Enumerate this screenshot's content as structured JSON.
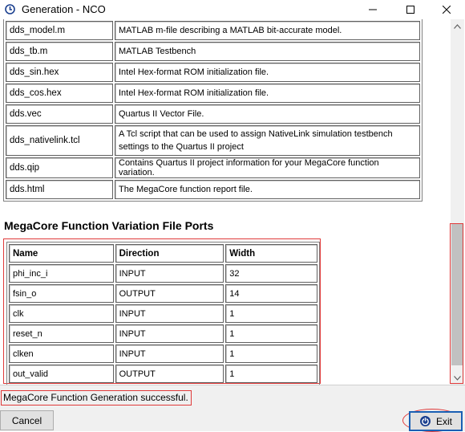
{
  "window": {
    "title": "Generation - NCO"
  },
  "files": [
    {
      "name": "dds_model.m",
      "description": "MATLAB m-file describing a MATLAB bit-accurate model."
    },
    {
      "name": "dds_tb.m",
      "description": "MATLAB Testbench"
    },
    {
      "name": "dds_sin.hex",
      "description": "Intel Hex-format ROM initialization file."
    },
    {
      "name": "dds_cos.hex",
      "description": "Intel Hex-format ROM initialization file."
    },
    {
      "name": "dds.vec",
      "description": "Quartus II Vector File."
    },
    {
      "name": "dds_nativelink.tcl",
      "description": "A Tcl script that can be used to assign NativeLink simulation testbench settings to the Quartus II project"
    },
    {
      "name": "dds.qip",
      "description": "Contains Quartus II project information for your MegaCore function variation."
    },
    {
      "name": "dds.html",
      "description": "The MegaCore function report file."
    }
  ],
  "ports_section": {
    "title": "MegaCore Function Variation File Ports",
    "headers": [
      "Name",
      "Direction",
      "Width"
    ],
    "rows": [
      [
        "phi_inc_i",
        "INPUT",
        "32"
      ],
      [
        "fsin_o",
        "OUTPUT",
        "14"
      ],
      [
        "clk",
        "INPUT",
        "1"
      ],
      [
        "reset_n",
        "INPUT",
        "1"
      ],
      [
        "clken",
        "INPUT",
        "1"
      ],
      [
        "out_valid",
        "OUTPUT",
        "1"
      ]
    ]
  },
  "status": {
    "message": "MegaCore Function Generation successful."
  },
  "buttons": {
    "cancel": "Cancel",
    "exit": "Exit"
  },
  "colors": {
    "highlight": "#e03a3a",
    "exit_border": "#1a5fb4",
    "app_icon": "#1a3f8f"
  },
  "icons": {
    "app": "nco-app-icon",
    "exit": "power-icon"
  }
}
